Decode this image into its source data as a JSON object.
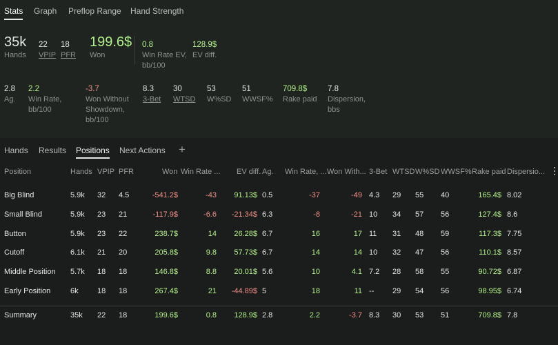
{
  "top_tabs": [
    {
      "label": "Stats",
      "active": true
    },
    {
      "label": "Graph",
      "active": false
    },
    {
      "label": "Preflop Range",
      "active": false
    },
    {
      "label": "Hand Strength",
      "active": false
    }
  ],
  "summary": {
    "hands": {
      "value": "35k",
      "label": "Hands"
    },
    "vpip": {
      "value": "22",
      "label": "VPIP"
    },
    "pfr": {
      "value": "18",
      "label": "PFR"
    },
    "won": {
      "value": "199.6$",
      "label": "Won"
    },
    "win_rate_ev": {
      "value": "0.8",
      "label_line1": "Win Rate EV,",
      "label_line2": "bb/100"
    },
    "ev_diff": {
      "value": "128.9$",
      "label": "EV diff."
    },
    "ag": {
      "value": "2.8",
      "label": "Ag."
    },
    "win_rate": {
      "value": "2.2",
      "label_line1": "Win Rate,",
      "label_line2": "bb/100"
    },
    "won_without_sd": {
      "value": "-3.7",
      "label_line1": "Won Without",
      "label_line2": "Showdown,",
      "label_line3": "bb/100"
    },
    "three_bet": {
      "value": "8.3",
      "label": "3-Bet"
    },
    "wtsd": {
      "value": "30",
      "label": "WTSD"
    },
    "wsd": {
      "value": "53",
      "label": "W%SD"
    },
    "wwsf": {
      "value": "51",
      "label": "WWSF%"
    },
    "rake": {
      "value": "709.8$",
      "label": "Rake paid"
    },
    "dispersion": {
      "value": "7.8",
      "label_line1": "Dispersion,",
      "label_line2": "bbs"
    }
  },
  "bottom_tabs": [
    {
      "label": "Hands",
      "active": false
    },
    {
      "label": "Results",
      "active": false
    },
    {
      "label": "Positions",
      "active": true
    },
    {
      "label": "Next Actions",
      "active": false
    }
  ],
  "add_tab_label": "+",
  "table": {
    "headers": [
      "Position",
      "Hands",
      "VPIP",
      "PFR",
      "Won",
      "Win Rate ...",
      "EV diff.",
      "Ag.",
      "Win Rate, ...",
      "Won With...",
      "3-Bet",
      "WTSD",
      "W%SD",
      "WWSF%",
      "Rake paid",
      "Dispersio..."
    ],
    "rows": [
      [
        "Big Blind",
        "5.9k",
        "32",
        "4.5",
        "-541.2$",
        "-43",
        "91.13$",
        "0.5",
        "-37",
        "-49",
        "4.3",
        "29",
        "55",
        "40",
        "165.4$",
        "8.02"
      ],
      [
        "Small Blind",
        "5.9k",
        "23",
        "21",
        "-117.9$",
        "-6.6",
        "-21.34$",
        "6.3",
        "-8",
        "-21",
        "10",
        "34",
        "57",
        "56",
        "127.4$",
        "8.6"
      ],
      [
        "Button",
        "5.9k",
        "23",
        "22",
        "238.7$",
        "14",
        "26.28$",
        "6.7",
        "16",
        "17",
        "11",
        "31",
        "48",
        "59",
        "117.3$",
        "7.75"
      ],
      [
        "Cutoff",
        "6.1k",
        "21",
        "20",
        "205.8$",
        "9.8",
        "57.73$",
        "6.7",
        "14",
        "14",
        "10",
        "32",
        "47",
        "56",
        "110.1$",
        "8.57"
      ],
      [
        "Middle Position",
        "5.7k",
        "18",
        "18",
        "146.8$",
        "8.8",
        "20.01$",
        "5.6",
        "10",
        "4.1",
        "7.2",
        "28",
        "58",
        "55",
        "90.72$",
        "6.87"
      ],
      [
        "Early Position",
        "6k",
        "18",
        "18",
        "267.4$",
        "21",
        "-44.89$",
        "5",
        "18",
        "11",
        "--",
        "29",
        "54",
        "56",
        "98.95$",
        "6.74"
      ]
    ],
    "summary_row": [
      "Summary",
      "35k",
      "22",
      "18",
      "199.6$",
      "0.8",
      "128.9$",
      "2.8",
      "2.2",
      "-3.7",
      "8.3",
      "30",
      "53",
      "51",
      "709.8$",
      "7.8"
    ]
  },
  "colors": {
    "positive": "#b4f08c",
    "negative": "#ef8f86",
    "background": "#1c1f1d"
  }
}
